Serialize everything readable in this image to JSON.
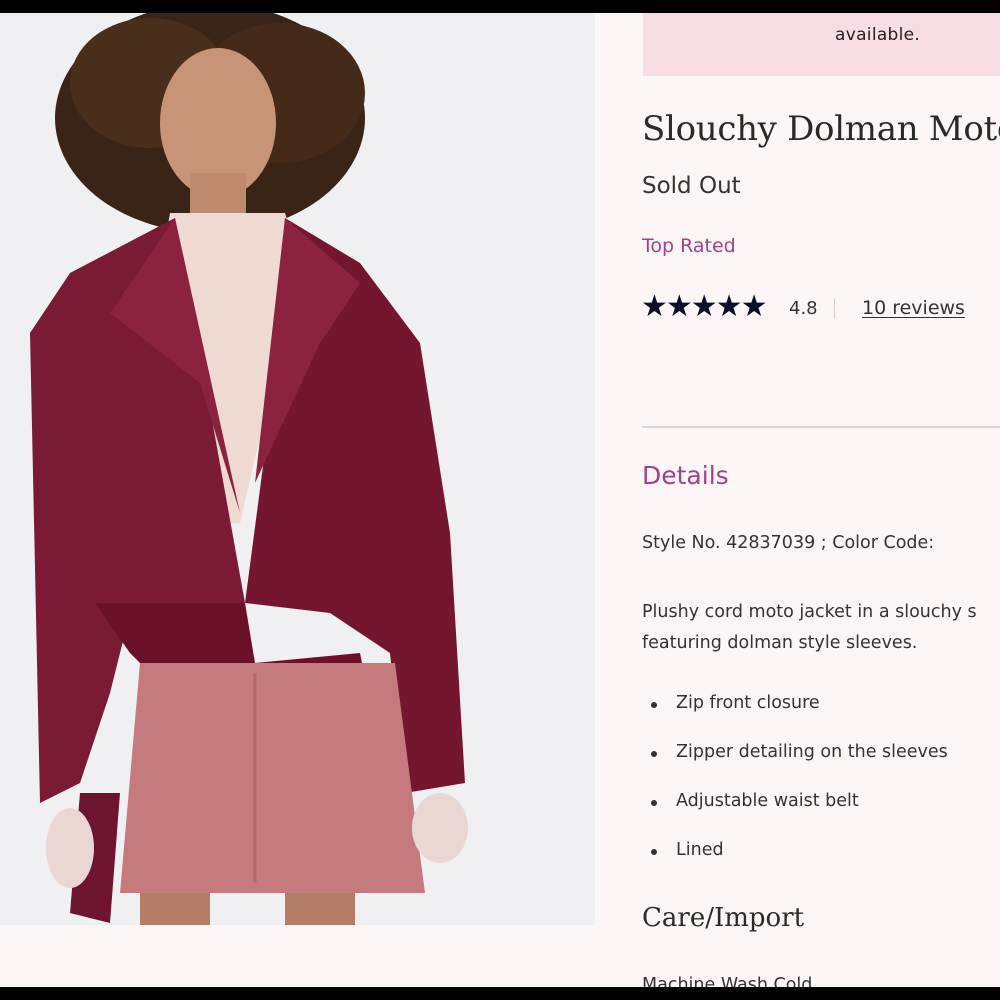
{
  "notice": {
    "text": "available."
  },
  "product": {
    "title": "Slouchy Dolman Moto",
    "availability": "Sold Out",
    "badge": "Top Rated",
    "rating": {
      "stars": "★★★★★",
      "value": "4.8",
      "reviews_label": "10 reviews"
    }
  },
  "details": {
    "heading": "Details",
    "style_line": "Style No. 42837039 ; Color Code:",
    "description_lines": [
      "Plushy cord moto jacket in a slouchy s",
      "featuring dolman style sleeves."
    ],
    "features": [
      "Zip front closure",
      "Zipper detailing on the sleeves",
      "Adjustable waist belt",
      "Lined"
    ]
  },
  "care": {
    "heading": "Care/Import",
    "text": "Machine Wash Cold"
  },
  "colors": {
    "accent": "#a1418a",
    "notice_bg": "#f8dee3",
    "jacket": "#7a1a35",
    "skirt": "#c57b7d",
    "star": "#0b0f2a"
  }
}
